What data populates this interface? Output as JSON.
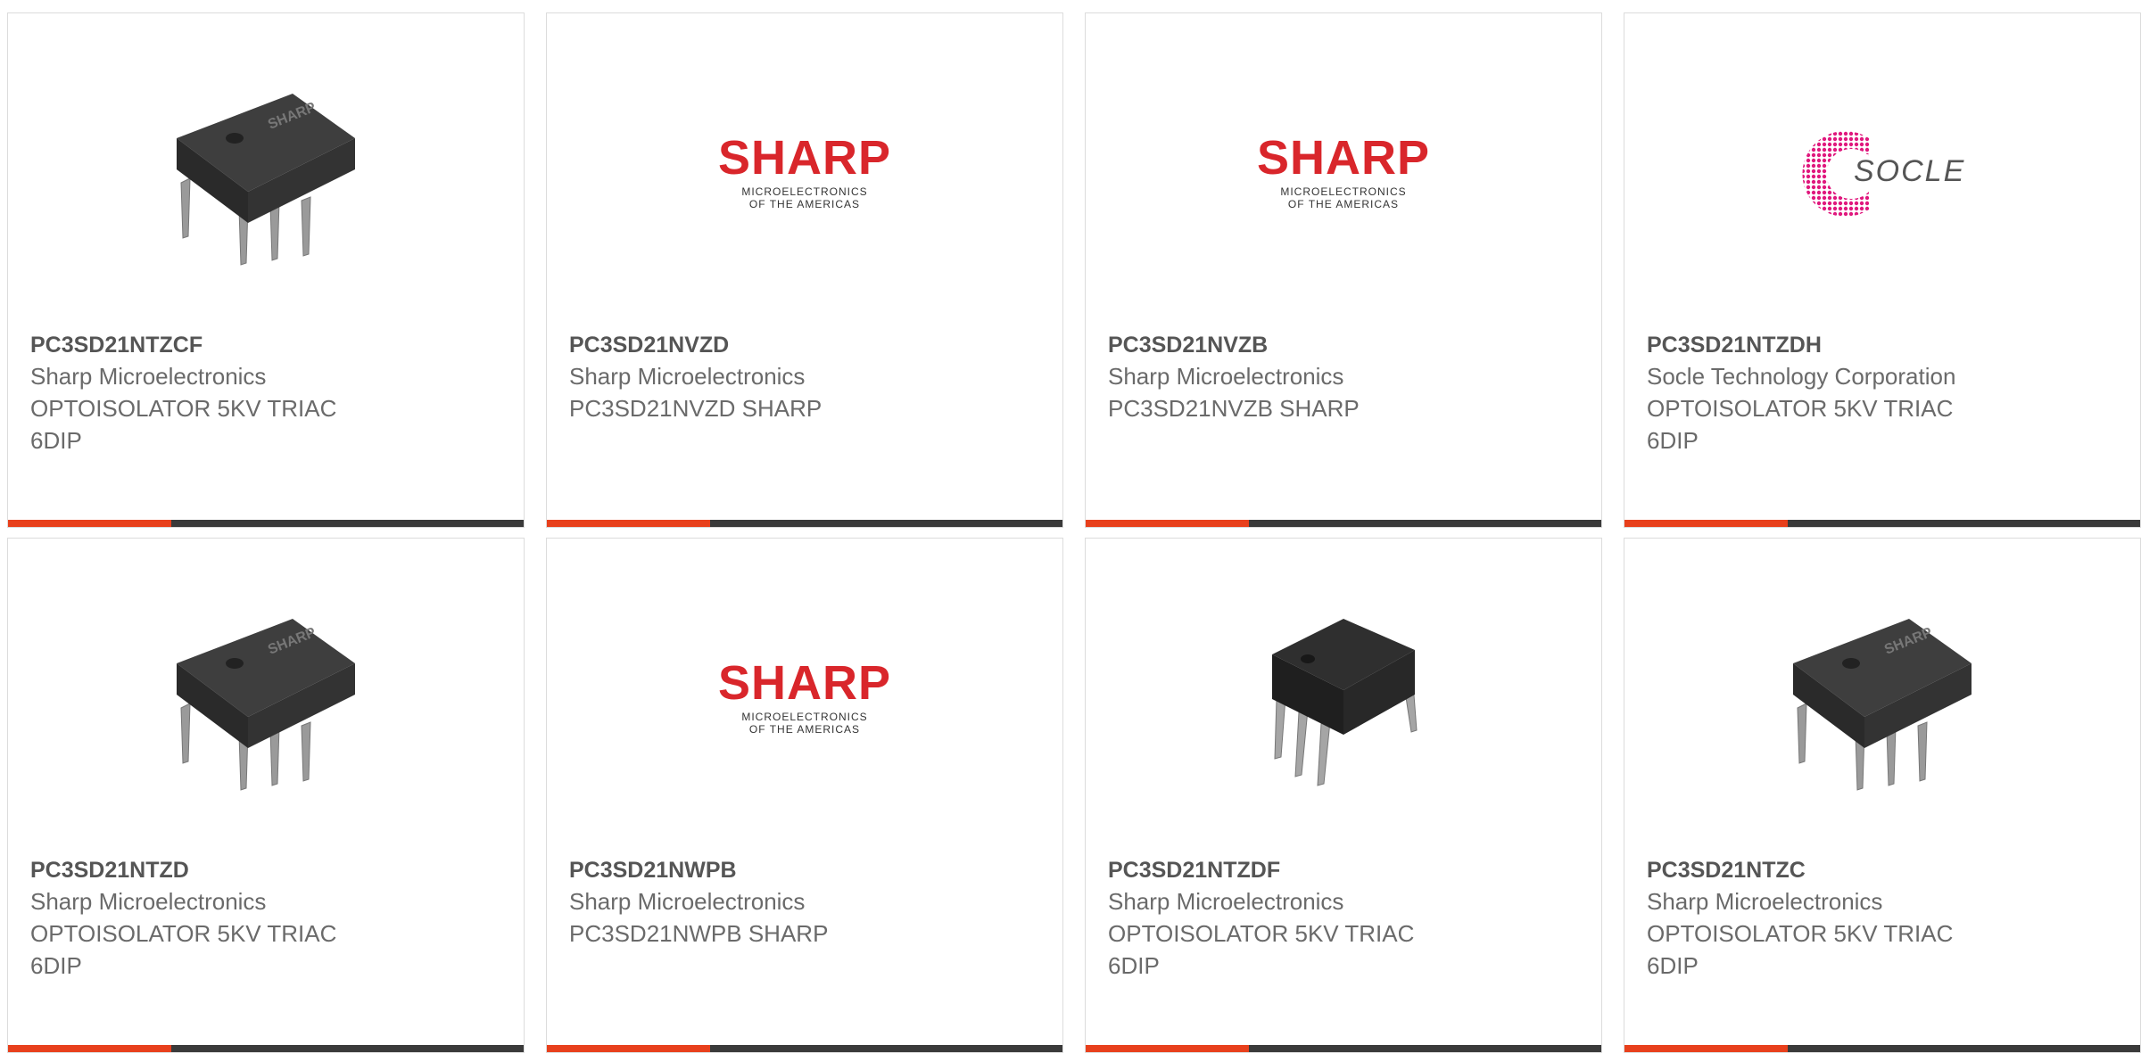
{
  "accent_color": "#e8401c",
  "bar_color": "#3a3a3a",
  "cards": [
    {
      "part": "PC3SD21NTZCF",
      "maker": "Sharp Microelectronics",
      "desc1": "OPTOISOLATOR 5KV TRIAC",
      "desc2": "6DIP",
      "image": "dip6-ic-photo"
    },
    {
      "part": "PC3SD21NVZD",
      "maker": "Sharp Microelectronics",
      "desc1": "PC3SD21NVZD SHARP",
      "desc2": "",
      "image": "sharp-logo"
    },
    {
      "part": "PC3SD21NVZB",
      "maker": "Sharp Microelectronics",
      "desc1": "PC3SD21NVZB SHARP",
      "desc2": "",
      "image": "sharp-logo"
    },
    {
      "part": "PC3SD21NTZDH",
      "maker": "Socle Technology Corporation",
      "desc1": "OPTOISOLATOR 5KV TRIAC",
      "desc2": "6DIP",
      "image": "socle-logo"
    },
    {
      "part": "PC3SD21NTZD",
      "maker": "Sharp Microelectronics",
      "desc1": "OPTOISOLATOR 5KV TRIAC",
      "desc2": "6DIP",
      "image": "dip6-ic-photo"
    },
    {
      "part": "PC3SD21NWPB",
      "maker": "Sharp Microelectronics",
      "desc1": "PC3SD21NWPB SHARP",
      "desc2": "",
      "image": "sharp-logo"
    },
    {
      "part": "PC3SD21NTZDF",
      "maker": "Sharp Microelectronics",
      "desc1": "OPTOISOLATOR 5KV TRIAC",
      "desc2": "6DIP",
      "image": "dip6-ic-photo-alt"
    },
    {
      "part": "PC3SD21NTZC",
      "maker": "Sharp Microelectronics",
      "desc1": "OPTOISOLATOR 5KV TRIAC",
      "desc2": "6DIP",
      "image": "dip6-ic-photo"
    }
  ],
  "logos": {
    "sharp": {
      "word": "SHARP",
      "line1": "MICROELECTRONICS",
      "line2": "OF THE AMERICAS",
      "color": "#d9262b"
    },
    "socle": {
      "word": "SOCLE",
      "color": "#e0177d"
    }
  }
}
